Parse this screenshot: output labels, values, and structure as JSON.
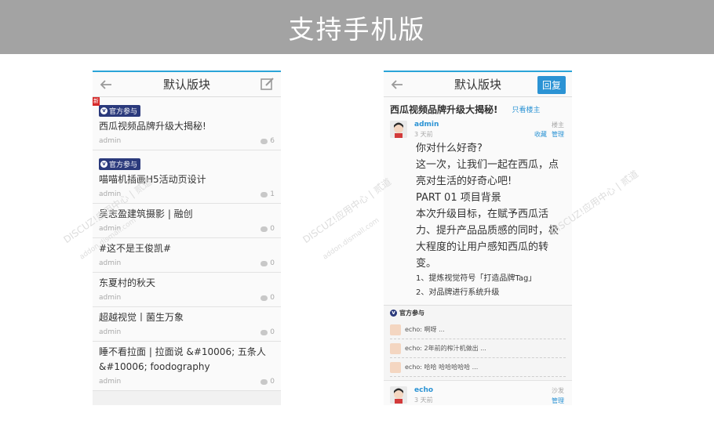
{
  "banner": {
    "title": "支持手机版"
  },
  "left_screen": {
    "header_title": "默认版块",
    "threads": [
      {
        "tag": "官方参与",
        "new": true,
        "new_label": "新",
        "title": "西瓜视频品牌升级大揭秘!",
        "author": "admin",
        "replies": "6"
      },
      {
        "tag": "官方参与",
        "new": false,
        "title": "喵喵机插画H5活动页设计",
        "author": "admin",
        "replies": "1"
      },
      {
        "tag": "",
        "new": false,
        "title": "吴志盈建筑摄影 | 融创",
        "author": "admin",
        "replies": "0"
      },
      {
        "tag": "",
        "new": false,
        "title": "#这不是王俊凯#",
        "author": "admin",
        "replies": "0"
      },
      {
        "tag": "",
        "new": false,
        "title": "东夏村的秋天",
        "author": "admin",
        "replies": "0"
      },
      {
        "tag": "",
        "new": false,
        "title": "超越视觉丨菌生万象",
        "author": "admin",
        "replies": "0"
      },
      {
        "tag": "",
        "new": false,
        "title": "睡不看拉面 | 拉面说 &#10006; 五条人 &#10006; foodography",
        "author": "admin",
        "replies": "0"
      }
    ]
  },
  "right_screen": {
    "header_title": "默认版块",
    "reply_label": "回复",
    "post_title": "西瓜视频品牌升级大揭秘!",
    "only_op_label": "只看楼主",
    "author": "admin",
    "time": "3 天前",
    "floor": "楼主",
    "favorite_label": "收藏",
    "manage_label": "管理",
    "body_lines": [
      "你对什么好奇?",
      "这一次，让我们一起在西瓜，点亮对生活的好奇心吧!",
      "PART 01 项目背景",
      "本次升级目标，在赋予西瓜活力、提升产品品质感的同时，极大程度的让用户感知西瓜的转变。"
    ],
    "list_lines": [
      "1、提炼视觉符号「打造品牌Tag」",
      "2、对品牌进行系统升级"
    ],
    "comments_tag": "官方参与",
    "comments": [
      "echo: 啊呀 ...",
      "echo: 2年前的榨汁机做出 ...",
      "echo: 哈哈 哈哈哈哈哈 ..."
    ],
    "second_post": {
      "author": "echo",
      "time": "3 天前",
      "floor": "沙发",
      "manage_label": "管理"
    }
  },
  "watermark": {
    "text": "DISCUZ!应用中心 | 贰道",
    "subtext": "addon.dismall.com"
  }
}
